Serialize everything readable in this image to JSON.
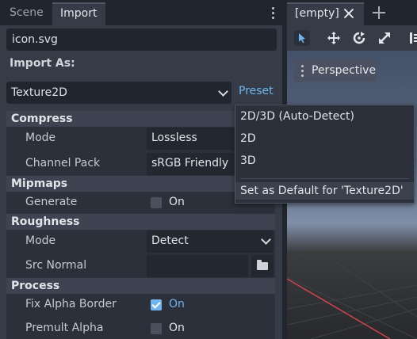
{
  "dock": {
    "tabs": [
      {
        "label": "Scene",
        "active": false
      },
      {
        "label": "Import",
        "active": true
      }
    ],
    "filename": "icon.svg",
    "import_as_label": "Import As:",
    "import_type": "Texture2D",
    "preset_label": "Preset",
    "sections": {
      "compress": "Compress",
      "mipmaps": "Mipmaps",
      "roughness": "Roughness",
      "process": "Process"
    },
    "rows": {
      "compress_mode": {
        "label": "Mode",
        "value": "Lossless"
      },
      "channel_pack": {
        "label": "Channel Pack",
        "value": "sRGB Friendly"
      },
      "mipmaps_generate": {
        "label": "Generate",
        "value": "On",
        "checked": false
      },
      "roughness_mode": {
        "label": "Mode",
        "value": "Detect"
      },
      "src_normal": {
        "label": "Src Normal",
        "value": ""
      },
      "fix_alpha_border": {
        "label": "Fix Alpha Border",
        "value": "On",
        "checked": true
      },
      "premult_alpha": {
        "label": "Premult Alpha",
        "value": "On",
        "checked": false
      }
    }
  },
  "viewport": {
    "tab_label": "[empty]",
    "view_mode": "Perspective",
    "tools": [
      "select-tool-icon",
      "move-tool-icon",
      "rotate-tool-icon",
      "scale-tool-icon",
      "list-tool-icon"
    ]
  },
  "preset_menu": {
    "items": [
      "2D/3D (Auto-Detect)",
      "2D",
      "3D"
    ],
    "set_default": "Set as Default for 'Texture2D'"
  },
  "colors": {
    "accent": "#6fb5f0",
    "panel": "#353b47",
    "background": "#21262e"
  }
}
